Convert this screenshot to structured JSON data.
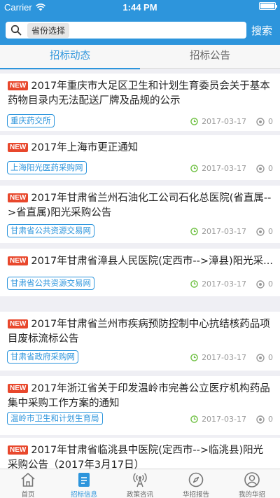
{
  "status": {
    "carrier": "Carrier",
    "time": "1:44 PM"
  },
  "search": {
    "province_label": "省份选择",
    "button": "搜索"
  },
  "tabs": [
    {
      "label": "招标动态"
    },
    {
      "label": "招标公告"
    }
  ],
  "new_badge": "NEW",
  "items": [
    {
      "title": "2017年重庆市大足区卫生和计划生育委员会关于基本药物目录内无法配送厂牌及品规的公示",
      "source": "重庆药交所",
      "date": "2017-03-17",
      "views": "0"
    },
    {
      "title": "2017年上海市更正通知",
      "source": "上海阳光医药采购网",
      "date": "2017-03-17",
      "views": "0"
    },
    {
      "title": "2017年甘肃省兰州石油化工公司石化总医院(省直属-->省直属)阳光采购公告",
      "source": "甘肃省公共资源交易网",
      "date": "2017-03-17",
      "views": "0"
    },
    {
      "title": "2017年甘肃省漳县人民医院(定西市-->漳县)阳光采...",
      "source": "甘肃省公共资源交易网",
      "date": "2017-03-17",
      "views": "0"
    },
    {
      "title": "2017年甘肃省兰州市疾病预防控制中心抗结核药品项目废标流标公告",
      "source": "甘肃省政府采购网",
      "date": "2017-03-17",
      "views": "0"
    },
    {
      "title": "2017年浙江省关于印发温岭市完善公立医疗机构药品集中采购工作方案的通知",
      "source": "温岭市卫生和计划生育局",
      "date": "2017-03-17",
      "views": "0"
    },
    {
      "title": "2017年甘肃省临洮县中医院(定西市-->临洮县)阳光采购公告（2017年3月17日）",
      "source": "",
      "date": "",
      "views": ""
    }
  ],
  "tabbar": [
    {
      "label": "首页",
      "icon": "home-icon"
    },
    {
      "label": "招标信息",
      "icon": "document-icon"
    },
    {
      "label": "政策咨讯",
      "icon": "broadcast-icon"
    },
    {
      "label": "华招报告",
      "icon": "compass-icon"
    },
    {
      "label": "我的华招",
      "icon": "user-icon"
    }
  ],
  "colors": {
    "primary": "#2d95dc",
    "badge": "#e8472c",
    "clock": "#6cbf3f"
  }
}
